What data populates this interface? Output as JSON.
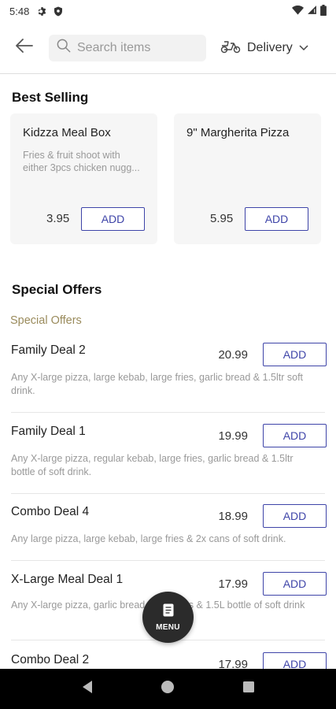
{
  "status": {
    "time": "5:48"
  },
  "header": {
    "search_placeholder": "Search items",
    "delivery_label": "Delivery"
  },
  "best_selling": {
    "title": "Best Selling",
    "items": [
      {
        "name": "Kidzza Meal Box",
        "desc": "Fries & fruit shoot with either 3pcs chicken nugg...",
        "price": "3.95",
        "add": "ADD"
      },
      {
        "name": "9\" Margherita Pizza",
        "desc": "",
        "price": "5.95",
        "add": "ADD"
      }
    ]
  },
  "special_offers": {
    "title": "Special Offers",
    "subtitle": "Special Offers",
    "items": [
      {
        "name": "Family Deal 2",
        "price": "20.99",
        "add": "ADD",
        "desc": "Any X-large pizza, large kebab, large fries, garlic bread & 1.5ltr soft drink."
      },
      {
        "name": "Family Deal 1",
        "price": "19.99",
        "add": "ADD",
        "desc": "Any X-large pizza, regular kebab, large fries, garlic bread & 1.5ltr bottle of soft drink."
      },
      {
        "name": "Combo Deal 4",
        "price": "18.99",
        "add": "ADD",
        "desc": "Any large pizza, large kebab, large fries & 2x cans of soft drink."
      },
      {
        "name": "X-Large Meal Deal 1",
        "price": "17.99",
        "add": "ADD",
        "desc": "Any X-large pizza, garlic bread, large fries & 1.5L bottle of soft drink"
      },
      {
        "name": "Combo Deal 2",
        "price": "17.99",
        "add": "ADD",
        "desc": ""
      }
    ]
  },
  "fab": {
    "label": "MENU"
  },
  "colors": {
    "accent": "#3e44a8",
    "subtitle": "#9a8b5c",
    "fab": "#2b2b2b"
  }
}
